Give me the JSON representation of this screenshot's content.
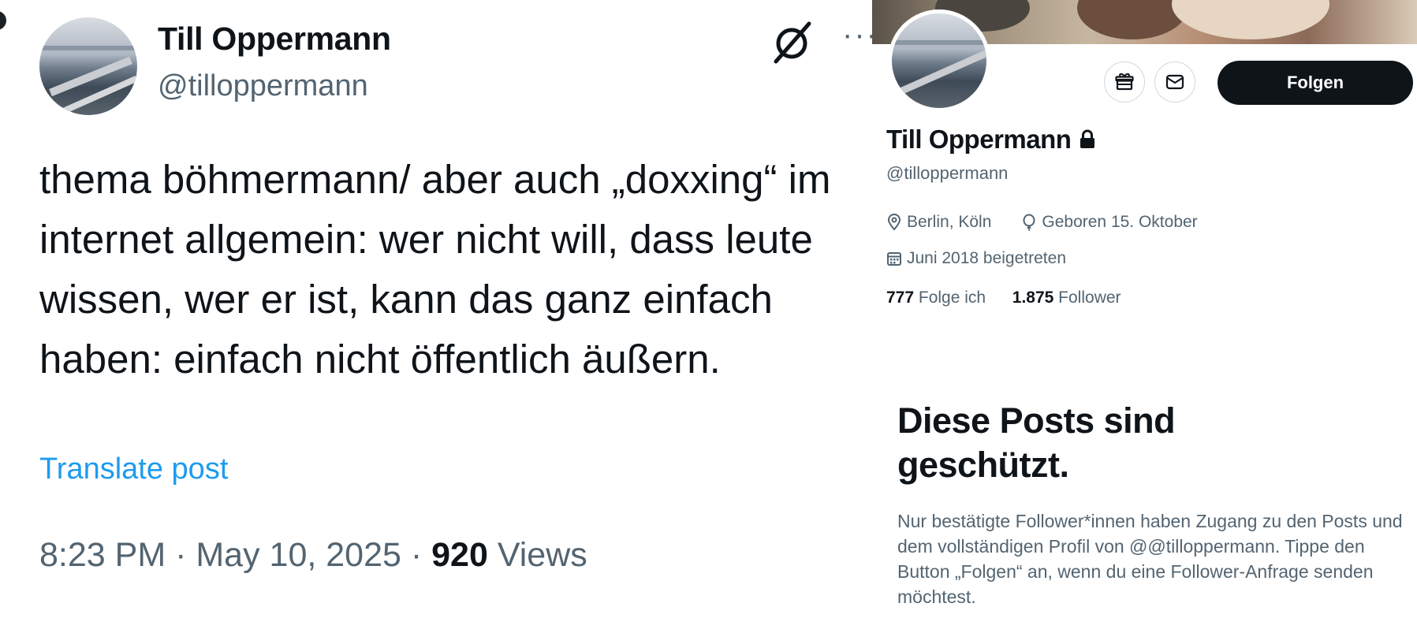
{
  "tweet": {
    "author_name": "Till Oppermann",
    "author_handle": "@tilloppermann",
    "text": "thema böhmermann/ aber auch „doxxing“ im internet allgemein: wer nicht will, dass leute wissen, wer er ist, kann das ganz einfach haben: einfach nicht öffentlich äußern.",
    "translate_label": "Translate post",
    "meta_time_date": "8:23 PM · May 10, 2025 · ",
    "views_count": "920",
    "views_label": " Views",
    "more_label": "···",
    "grok_icon": "grok-icon"
  },
  "profile": {
    "name": "Till Oppermann",
    "handle": "@tilloppermann",
    "follow_label": "Folgen",
    "location": "Berlin, Köln",
    "birthday": "Geboren 15. Oktober",
    "joined": "Juni 2018 beigetreten",
    "following_count": "777",
    "following_label": " Folge ich",
    "followers_count": "1.875",
    "followers_label": " Follower",
    "protected_title": "Diese Posts sind geschützt.",
    "protected_text": "Nur bestätigte Follower*innen haben Zugang zu den Posts und dem vollständigen Profil von @@tilloppermann. Tippe den Button „Folgen“ an, wenn du eine Follower-Anfrage senden möchtest."
  },
  "colors": {
    "link": "#1d9bf0",
    "secondary_text": "#536471",
    "primary_text": "#0f1419",
    "button_bg": "#0f1419"
  }
}
